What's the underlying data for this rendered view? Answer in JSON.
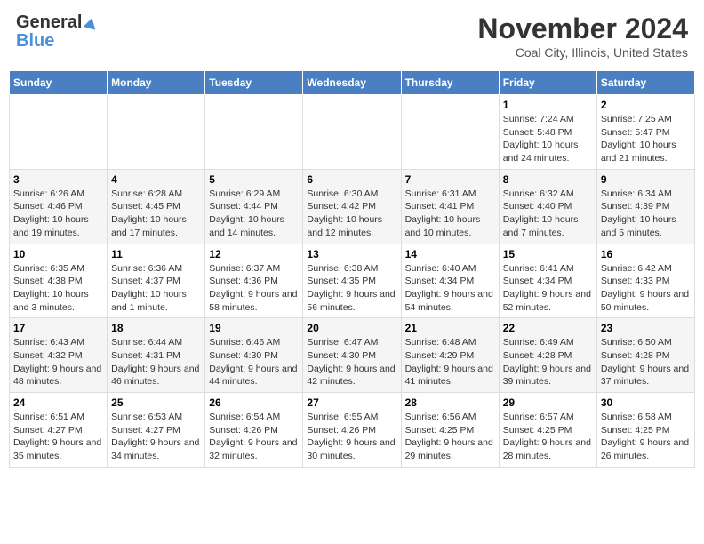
{
  "header": {
    "logo_line1": "General",
    "logo_line2": "Blue",
    "month_title": "November 2024",
    "location": "Coal City, Illinois, United States"
  },
  "days_of_week": [
    "Sunday",
    "Monday",
    "Tuesday",
    "Wednesday",
    "Thursday",
    "Friday",
    "Saturday"
  ],
  "weeks": [
    [
      {
        "day": "",
        "info": ""
      },
      {
        "day": "",
        "info": ""
      },
      {
        "day": "",
        "info": ""
      },
      {
        "day": "",
        "info": ""
      },
      {
        "day": "",
        "info": ""
      },
      {
        "day": "1",
        "info": "Sunrise: 7:24 AM\nSunset: 5:48 PM\nDaylight: 10 hours and 24 minutes."
      },
      {
        "day": "2",
        "info": "Sunrise: 7:25 AM\nSunset: 5:47 PM\nDaylight: 10 hours and 21 minutes."
      }
    ],
    [
      {
        "day": "3",
        "info": "Sunrise: 6:26 AM\nSunset: 4:46 PM\nDaylight: 10 hours and 19 minutes."
      },
      {
        "day": "4",
        "info": "Sunrise: 6:28 AM\nSunset: 4:45 PM\nDaylight: 10 hours and 17 minutes."
      },
      {
        "day": "5",
        "info": "Sunrise: 6:29 AM\nSunset: 4:44 PM\nDaylight: 10 hours and 14 minutes."
      },
      {
        "day": "6",
        "info": "Sunrise: 6:30 AM\nSunset: 4:42 PM\nDaylight: 10 hours and 12 minutes."
      },
      {
        "day": "7",
        "info": "Sunrise: 6:31 AM\nSunset: 4:41 PM\nDaylight: 10 hours and 10 minutes."
      },
      {
        "day": "8",
        "info": "Sunrise: 6:32 AM\nSunset: 4:40 PM\nDaylight: 10 hours and 7 minutes."
      },
      {
        "day": "9",
        "info": "Sunrise: 6:34 AM\nSunset: 4:39 PM\nDaylight: 10 hours and 5 minutes."
      }
    ],
    [
      {
        "day": "10",
        "info": "Sunrise: 6:35 AM\nSunset: 4:38 PM\nDaylight: 10 hours and 3 minutes."
      },
      {
        "day": "11",
        "info": "Sunrise: 6:36 AM\nSunset: 4:37 PM\nDaylight: 10 hours and 1 minute."
      },
      {
        "day": "12",
        "info": "Sunrise: 6:37 AM\nSunset: 4:36 PM\nDaylight: 9 hours and 58 minutes."
      },
      {
        "day": "13",
        "info": "Sunrise: 6:38 AM\nSunset: 4:35 PM\nDaylight: 9 hours and 56 minutes."
      },
      {
        "day": "14",
        "info": "Sunrise: 6:40 AM\nSunset: 4:34 PM\nDaylight: 9 hours and 54 minutes."
      },
      {
        "day": "15",
        "info": "Sunrise: 6:41 AM\nSunset: 4:34 PM\nDaylight: 9 hours and 52 minutes."
      },
      {
        "day": "16",
        "info": "Sunrise: 6:42 AM\nSunset: 4:33 PM\nDaylight: 9 hours and 50 minutes."
      }
    ],
    [
      {
        "day": "17",
        "info": "Sunrise: 6:43 AM\nSunset: 4:32 PM\nDaylight: 9 hours and 48 minutes."
      },
      {
        "day": "18",
        "info": "Sunrise: 6:44 AM\nSunset: 4:31 PM\nDaylight: 9 hours and 46 minutes."
      },
      {
        "day": "19",
        "info": "Sunrise: 6:46 AM\nSunset: 4:30 PM\nDaylight: 9 hours and 44 minutes."
      },
      {
        "day": "20",
        "info": "Sunrise: 6:47 AM\nSunset: 4:30 PM\nDaylight: 9 hours and 42 minutes."
      },
      {
        "day": "21",
        "info": "Sunrise: 6:48 AM\nSunset: 4:29 PM\nDaylight: 9 hours and 41 minutes."
      },
      {
        "day": "22",
        "info": "Sunrise: 6:49 AM\nSunset: 4:28 PM\nDaylight: 9 hours and 39 minutes."
      },
      {
        "day": "23",
        "info": "Sunrise: 6:50 AM\nSunset: 4:28 PM\nDaylight: 9 hours and 37 minutes."
      }
    ],
    [
      {
        "day": "24",
        "info": "Sunrise: 6:51 AM\nSunset: 4:27 PM\nDaylight: 9 hours and 35 minutes."
      },
      {
        "day": "25",
        "info": "Sunrise: 6:53 AM\nSunset: 4:27 PM\nDaylight: 9 hours and 34 minutes."
      },
      {
        "day": "26",
        "info": "Sunrise: 6:54 AM\nSunset: 4:26 PM\nDaylight: 9 hours and 32 minutes."
      },
      {
        "day": "27",
        "info": "Sunrise: 6:55 AM\nSunset: 4:26 PM\nDaylight: 9 hours and 30 minutes."
      },
      {
        "day": "28",
        "info": "Sunrise: 6:56 AM\nSunset: 4:25 PM\nDaylight: 9 hours and 29 minutes."
      },
      {
        "day": "29",
        "info": "Sunrise: 6:57 AM\nSunset: 4:25 PM\nDaylight: 9 hours and 28 minutes."
      },
      {
        "day": "30",
        "info": "Sunrise: 6:58 AM\nSunset: 4:25 PM\nDaylight: 9 hours and 26 minutes."
      }
    ]
  ]
}
